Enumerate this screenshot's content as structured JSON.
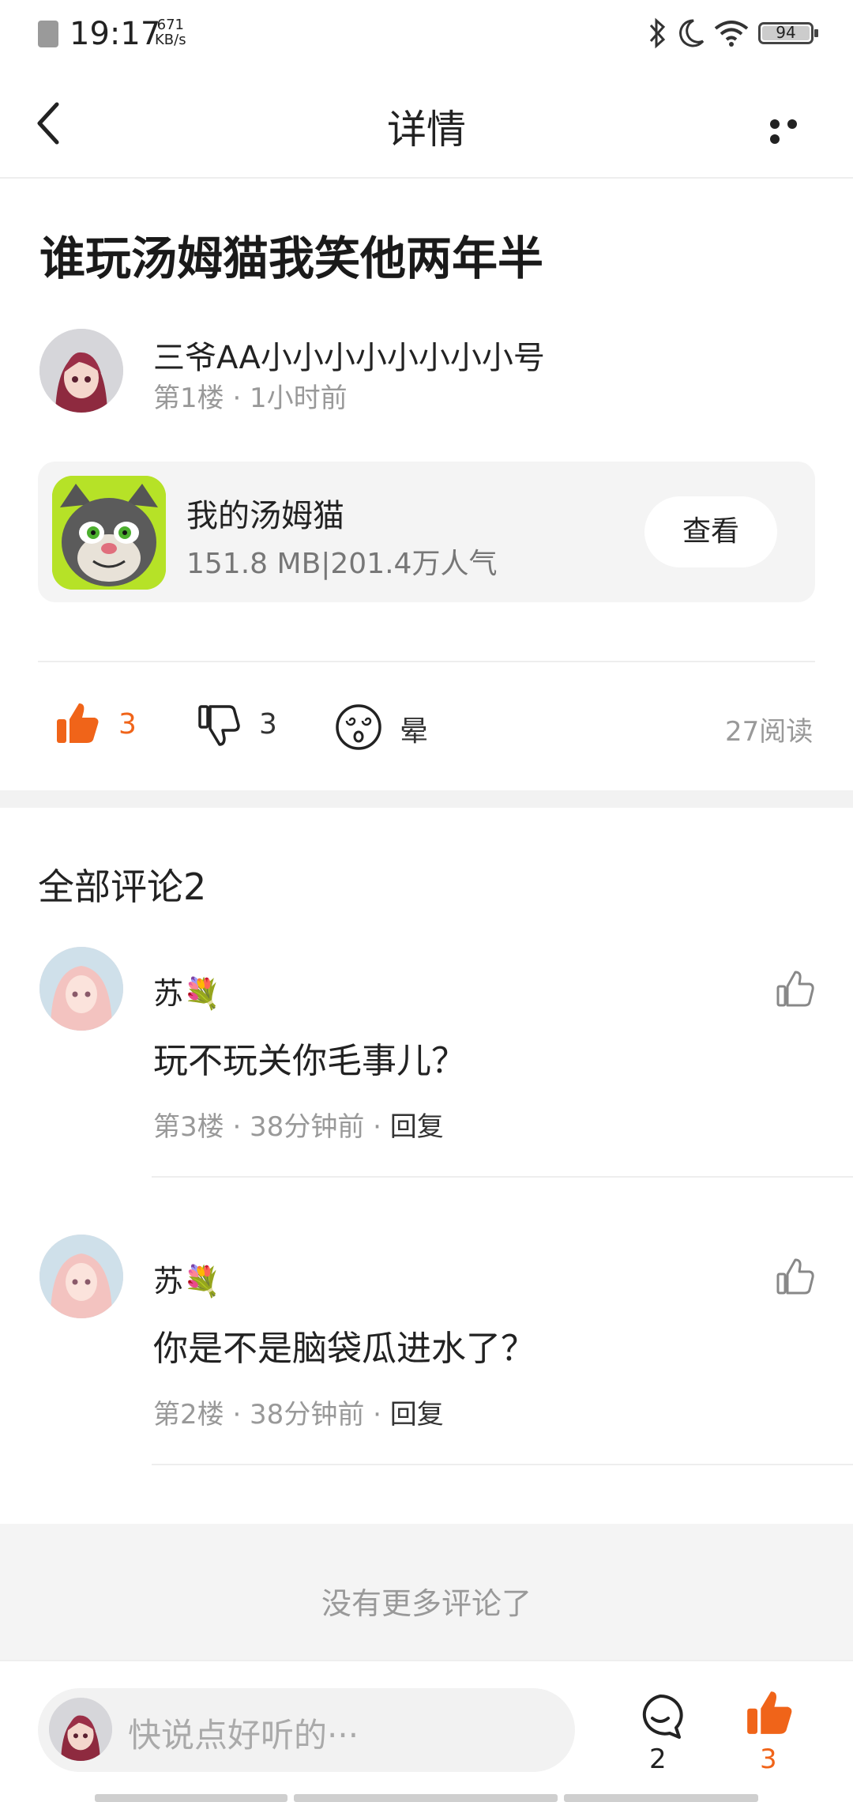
{
  "status_bar": {
    "time": "19:17",
    "speed_value": "671",
    "speed_unit": "KB/s",
    "battery": "94"
  },
  "header": {
    "title": "详情"
  },
  "post": {
    "title": "谁玩汤姆猫我笑他两年半",
    "author": "三爷AA小小小小小小小小号",
    "meta": "第1楼 · 1小时前"
  },
  "app_card": {
    "name": "我的汤姆猫",
    "info": "151.8 MB|201.4万人气",
    "button": "查看"
  },
  "reactions": {
    "like_count": "3",
    "dislike_count": "3",
    "dizzy_label": "晕",
    "reads": "27阅读"
  },
  "comments": {
    "heading": "全部评论2",
    "items": [
      {
        "name": "苏",
        "badge": "💐",
        "text": "玩不玩关你毛事儿？",
        "meta": "第3楼 · 38分钟前 · ",
        "reply": "回复"
      },
      {
        "name": "苏",
        "badge": "💐",
        "text": "你是不是脑袋瓜进水了？",
        "meta": "第2楼 · 38分钟前 · ",
        "reply": "回复"
      }
    ],
    "no_more": "没有更多评论了"
  },
  "bottom_bar": {
    "placeholder": "快说点好听的···",
    "comment_count": "2",
    "like_count": "3"
  },
  "colors": {
    "accent": "#f06419",
    "muted": "#999999",
    "bg_light": "#f4f4f4"
  },
  "icons": [
    "back-arrow-icon",
    "more-icon",
    "thumbs-up-icon",
    "thumbs-down-icon",
    "dizzy-face-icon",
    "comment-bubble-icon",
    "bluetooth-icon",
    "moon-icon",
    "wifi-icon",
    "battery-icon"
  ]
}
